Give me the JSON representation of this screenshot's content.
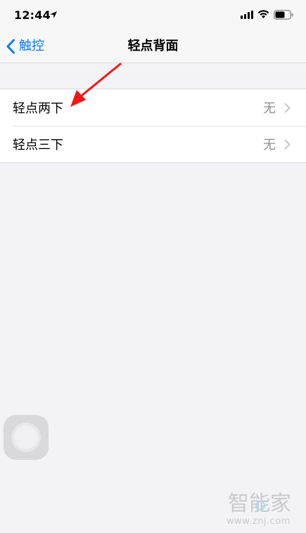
{
  "status_bar": {
    "time": "12:44",
    "icons": [
      "location-arrow-icon",
      "signal-bars-icon",
      "wifi-icon",
      "battery-icon"
    ]
  },
  "nav": {
    "back_label": "触控",
    "title": "轻点背面"
  },
  "rows": [
    {
      "label": "轻点两下",
      "value": "无"
    },
    {
      "label": "轻点三下",
      "value": "无"
    }
  ],
  "annotation": {
    "color": "#ff0000",
    "type": "red-arrow-pointing-left-down"
  },
  "watermark": {
    "logo_text": "智能家",
    "url": "www.znj.com"
  },
  "colors": {
    "accent": "#0a7aff",
    "background": "#f2f2f7",
    "secondary_text": "#8e8e93"
  }
}
